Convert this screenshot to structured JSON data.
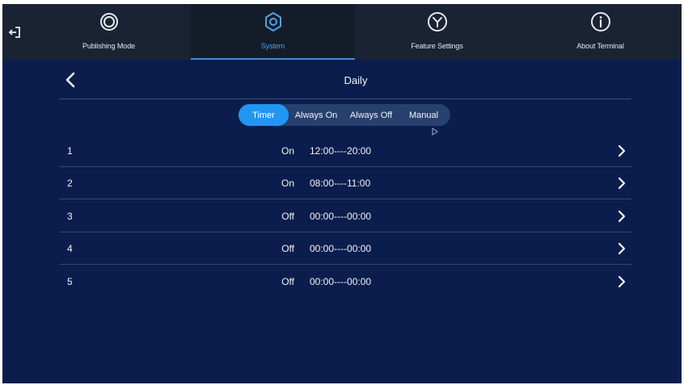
{
  "topbar": {
    "exit_icon": "exit-icon",
    "tabs": [
      {
        "label": "Publishing Mode",
        "icon": "publishing-mode-icon",
        "active": false
      },
      {
        "label": "System",
        "icon": "gear-icon",
        "active": true
      },
      {
        "label": "Feature Settings",
        "icon": "feature-settings-icon",
        "active": false
      },
      {
        "label": "About Terminal",
        "icon": "info-icon",
        "active": false
      }
    ]
  },
  "header": {
    "back_icon": "chevron-left-icon",
    "title": "Daily"
  },
  "modes": {
    "options": [
      "Timer",
      "Always On",
      "Always Off",
      "Manual"
    ],
    "selected": "Timer"
  },
  "schedules": [
    {
      "index": "1",
      "state": "On",
      "range": "12:00----20:00"
    },
    {
      "index": "2",
      "state": "On",
      "range": "08:00----11:00"
    },
    {
      "index": "3",
      "state": "Off",
      "range": "00:00----00:00"
    },
    {
      "index": "4",
      "state": "Off",
      "range": "00:00----00:00"
    },
    {
      "index": "5",
      "state": "Off",
      "range": "00:00----00:00"
    }
  ],
  "colors": {
    "background": "#0b1d4c",
    "topbar": "#1a2333",
    "accent": "#2196f3",
    "active_tab_text": "#4aa3e8"
  }
}
